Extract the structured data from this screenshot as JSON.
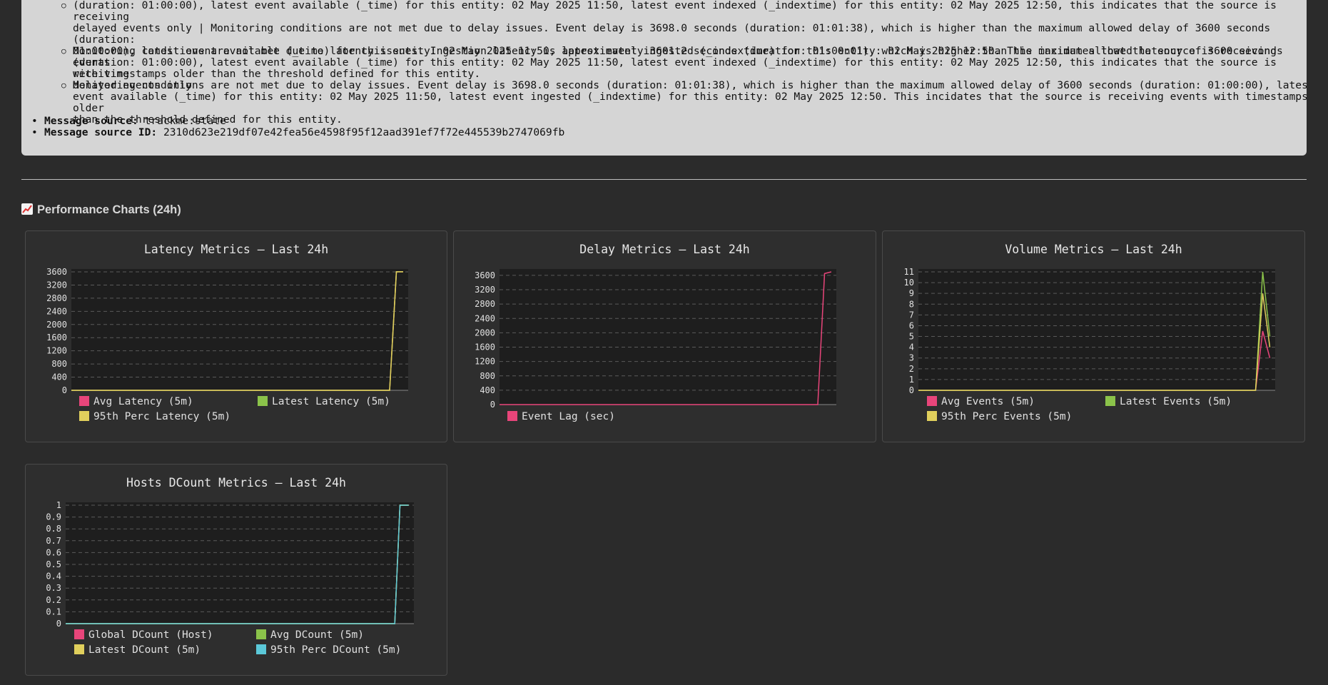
{
  "message": {
    "sub_items": [
      {
        "lines": [
          "(duration: 01:00:00), latest event available (_time) for this entity: 02 May 2025 11:50, latest event indexed (_indextime) for this entity: 02 May 2025 12:50, this indicates that the source is receiving",
          "delayed events only | Monitoring conditions are not met due to delay issues. Event delay is 3698.0 seconds (duration: 01:01:38), which is higher than the maximum allowed delay of 3600 seconds (duration:",
          "01:00:00), latest event available (_time) for this entity: 02 May 2025 11:50, latest event ingested (_indextime) for this entity: 02 May 2025 12:50. This incidates that the source is receiving events",
          "with timestamps older than the threshold defined for this entity."
        ]
      },
      {
        "lines": [
          "Monitoring conditions are not met due to latency issues. Ingestion latency is approximately 3601.2 seconds (duration: 01:00:01), which is higher than the maximum allowed latency of 3600 seconds",
          "(duration: 01:00:00), latest event available (_time) for this entity: 02 May 2025 11:50, latest event indexed (_indextime) for this entity: 02 May 2025 12:50, this indicates that the source is receiving",
          "delayed events only"
        ]
      },
      {
        "lines": [
          "Monitoring conditions are not met due to delay issues. Event delay is 3698.0 seconds (duration: 01:01:38), which is higher than the maximum allowed delay of 3600 seconds (duration: 01:00:00), latest",
          "event available (_time) for this entity: 02 May 2025 11:50, latest event ingested (_indextime) for this entity: 02 May 2025 12:50. This incidates that the source is receiving events with timestamps older",
          "than the threshold defined for this entity."
        ]
      }
    ],
    "source_label": "Message source:",
    "source_value": "trackme:state",
    "source_id_label": "Message source ID:",
    "source_id_value": "2310d623e219df07e42fea56e4598f95f12aad391ef7f72e445539b2747069fb"
  },
  "section_title": "Performance Charts (24h)",
  "section_icon": "chart-increasing-icon",
  "colors": {
    "red": "#e8457a",
    "green": "#8bc34a",
    "yellow": "#e0cf5c",
    "cyan": "#5bc8d8",
    "plot_bg": "#1e1e1e",
    "panel_bg": "#2e2e2e"
  },
  "chart_data": [
    {
      "type": "line",
      "title": "Latency Metrics – Last 24h",
      "ylim": [
        0,
        3600
      ],
      "yticks": [
        "0",
        "400",
        "800",
        "1200",
        "1600",
        "2000",
        "2400",
        "2800",
        "3200",
        "3600"
      ],
      "grid": true,
      "legend_position": "bottom",
      "series": [
        {
          "name": "Avg Latency (5m)",
          "color": "red",
          "values": [
            0,
            0,
            3601.2,
            3601.2
          ]
        },
        {
          "name": "Latest Latency (5m)",
          "color": "green",
          "values": [
            0,
            0,
            3601.2,
            3601.2
          ]
        },
        {
          "name": "95th Perc Latency (5m)",
          "color": "yellow",
          "values": [
            0,
            0,
            3601.2,
            3601.2
          ]
        }
      ],
      "x": [
        0,
        0.945,
        0.965,
        0.985
      ]
    },
    {
      "type": "line",
      "title": "Delay Metrics – Last 24h",
      "ylim": [
        0,
        3698
      ],
      "yticks": [
        "0",
        "400",
        "800",
        "1200",
        "1600",
        "2000",
        "2400",
        "2800",
        "3200",
        "3600"
      ],
      "grid": true,
      "legend_position": "bottom",
      "series": [
        {
          "name": "Event Lag (sec)",
          "color": "red",
          "values": [
            0,
            0,
            3650,
            3698
          ]
        }
      ],
      "x": [
        0,
        0.945,
        0.965,
        0.985
      ]
    },
    {
      "type": "line",
      "title": "Volume Metrics – Last 24h",
      "ylim": [
        0,
        11
      ],
      "yticks": [
        "0",
        "1",
        "2",
        "3",
        "4",
        "5",
        "6",
        "7",
        "8",
        "9",
        "10",
        "11"
      ],
      "grid": true,
      "legend_position": "bottom",
      "series": [
        {
          "name": "Avg Events (5m)",
          "color": "red",
          "values": [
            0,
            0,
            5.5,
            3
          ]
        },
        {
          "name": "Latest Events (5m)",
          "color": "green",
          "values": [
            0,
            0,
            11,
            5
          ]
        },
        {
          "name": "95th Perc Events (5m)",
          "color": "yellow",
          "values": [
            0,
            0,
            9,
            4
          ]
        }
      ],
      "x": [
        0,
        0.945,
        0.965,
        0.985
      ]
    },
    {
      "type": "line",
      "title": "Hosts DCount Metrics – Last 24h",
      "ylim": [
        0,
        1
      ],
      "yticks": [
        "0",
        "0.1",
        "0.2",
        "0.3",
        "0.4",
        "0.5",
        "0.6",
        "0.7",
        "0.8",
        "0.9",
        "1"
      ],
      "grid": true,
      "legend_position": "bottom",
      "series": [
        {
          "name": "Global DCount (Host)",
          "color": "red",
          "values": [
            0,
            0,
            1,
            1
          ]
        },
        {
          "name": "Avg DCount (5m)",
          "color": "green",
          "values": [
            0,
            0,
            1,
            1
          ]
        },
        {
          "name": "Latest DCount (5m)",
          "color": "yellow",
          "values": [
            0,
            0,
            1,
            1
          ]
        },
        {
          "name": "95th Perc DCount (5m)",
          "color": "cyan",
          "values": [
            0,
            0,
            1,
            1
          ]
        }
      ],
      "x": [
        0,
        0.945,
        0.96,
        0.985
      ]
    }
  ]
}
